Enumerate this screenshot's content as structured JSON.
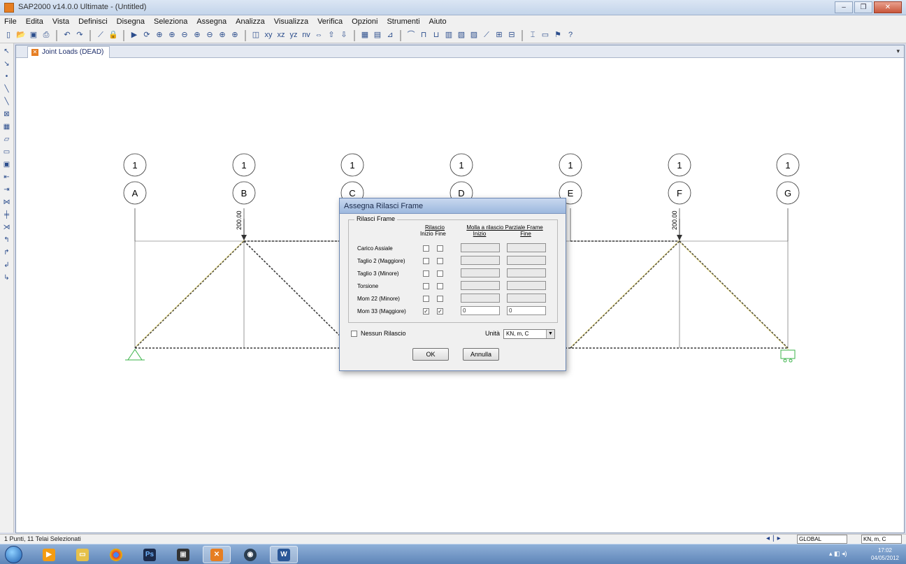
{
  "window": {
    "title": "SAP2000 v14.0.0 Ultimate - (Untitled)",
    "controls": [
      "–",
      "❐",
      "✕"
    ]
  },
  "menu": [
    "File",
    "Edita",
    "Vista",
    "Definisci",
    "Disegna",
    "Seleziona",
    "Assegna",
    "Analizza",
    "Visualizza",
    "Verifica",
    "Opzioni",
    "Strumenti",
    "Aiuto"
  ],
  "document": {
    "tab_title": "Joint Loads (DEAD)"
  },
  "grid": {
    "columns": [
      "A",
      "B",
      "C",
      "D",
      "E",
      "F",
      "G"
    ],
    "row_label": "1"
  },
  "loads": {
    "label": "200.00"
  },
  "dialog": {
    "title": "Assegna Rilasci Frame",
    "group_title": "Rilasci Frame",
    "release_header": "Rilascio",
    "col_inizio": "Inizio",
    "col_fine": "Fine",
    "spring_header": "Molla a rilascio Parziale Frame",
    "spring_inizio": "Inizio",
    "spring_fine": "Fine",
    "rows": [
      {
        "label": "Carico Assiale",
        "inizio": false,
        "fine": false,
        "v_inizio": "",
        "v_fine": ""
      },
      {
        "label": "Taglio 2 (Maggiore)",
        "inizio": false,
        "fine": false,
        "v_inizio": "",
        "v_fine": ""
      },
      {
        "label": "Taglio 3 (Minore)",
        "inizio": false,
        "fine": false,
        "v_inizio": "",
        "v_fine": ""
      },
      {
        "label": "Torsione",
        "inizio": false,
        "fine": false,
        "v_inizio": "",
        "v_fine": ""
      },
      {
        "label": "Mom 22 (Minore)",
        "inizio": false,
        "fine": false,
        "v_inizio": "",
        "v_fine": ""
      },
      {
        "label": "Mom 33 (Maggiore)",
        "inizio": true,
        "fine": true,
        "v_inizio": "0",
        "v_fine": "0"
      }
    ],
    "no_release_label": "Nessun Rilascio",
    "units_label": "Unità",
    "units_value": "KN, m, C",
    "ok_label": "OK",
    "cancel_label": "Annulla"
  },
  "status": {
    "text": "1 Punti, 11 Telai Selezionati",
    "coord_system": "GLOBAL",
    "units": "KN, m, C"
  },
  "taskbar": {
    "clock_time": "17:02",
    "clock_date": "04/05/2012"
  }
}
